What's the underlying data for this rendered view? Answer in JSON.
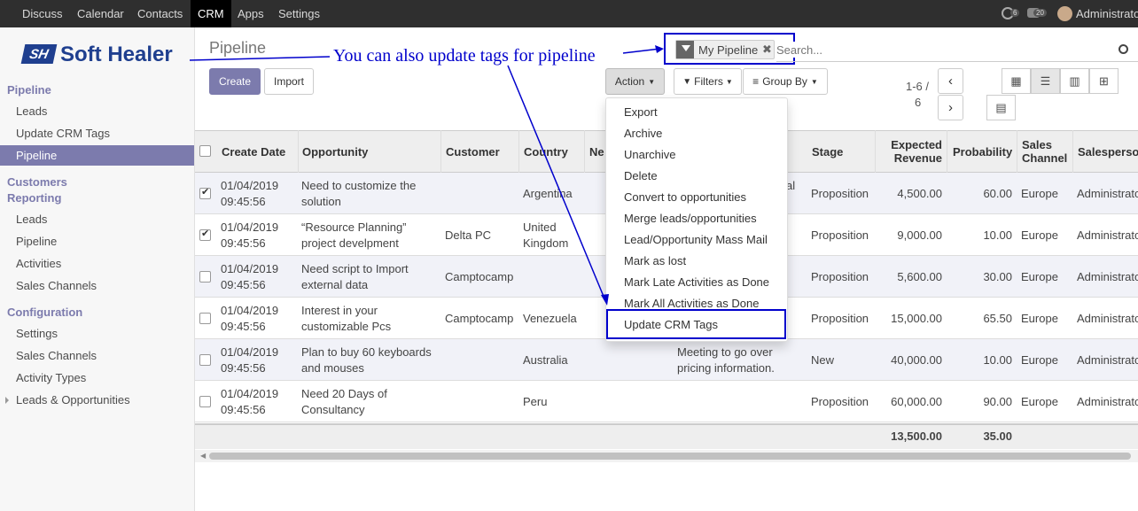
{
  "topbar": {
    "menus": [
      "Discuss",
      "Calendar",
      "Contacts",
      "CRM",
      "Apps",
      "Settings"
    ],
    "active": "CRM",
    "badge1": "6",
    "badge2": "20",
    "user": "Administrato"
  },
  "brand": {
    "name": "Soft Healer",
    "mark": "SH"
  },
  "sidebar": {
    "sec1": "Pipeline",
    "items1": [
      "Leads",
      "Update CRM Tags",
      "Pipeline"
    ],
    "sec2a": "Customers",
    "sec2b": "Reporting",
    "items2": [
      "Leads",
      "Pipeline",
      "Activities",
      "Sales Channels"
    ],
    "sec3": "Configuration",
    "items3": [
      "Settings",
      "Sales Channels",
      "Activity Types",
      "Leads & Opportunities"
    ]
  },
  "main": {
    "breadcrumb": "Pipeline",
    "create": "Create",
    "import": "Import",
    "action": "Action",
    "filters": "Filters",
    "groupby": "Group By",
    "pager": "1-6 /",
    "pager2": "6"
  },
  "search": {
    "facet": "My Pipeline",
    "placeholder": "Search..."
  },
  "annotation": "You can also update tags for pipeline",
  "table": {
    "headers": [
      "Create Date",
      "Opportunity",
      "Customer",
      "Country",
      "Ne",
      "Stage",
      "Expected",
      "Revenue",
      "Probability",
      "Sales",
      "Channel",
      "Salesperso"
    ],
    "rows": [
      {
        "d1": "01/04/2019",
        "d2": "09:45:56",
        "o1": "Need to customize the",
        "o2": "solution",
        "cust": "",
        "c1": "Argentina",
        "c2": "",
        "act": "al",
        "act2": "",
        "stage": "Proposition",
        "rev": "4,500.00",
        "prob": "60.00",
        "chan": "Europe",
        "sp": "Administrato",
        "checked": true
      },
      {
        "d1": "01/04/2019",
        "d2": "09:45:56",
        "o1": "“Resource Planning”",
        "o2": "project develpment",
        "cust": "Delta PC",
        "c1": "United",
        "c2": "Kingdom",
        "act": "",
        "act2": "",
        "stage": "Proposition",
        "rev": "9,000.00",
        "prob": "10.00",
        "chan": "Europe",
        "sp": "Administrato",
        "checked": true
      },
      {
        "d1": "01/04/2019",
        "d2": "09:45:56",
        "o1": "Need script to Import",
        "o2": "external data",
        "cust": "Camptocamp",
        "c1": "",
        "c2": "",
        "act": "",
        "act2": "",
        "stage": "Proposition",
        "rev": "5,600.00",
        "prob": "30.00",
        "chan": "Europe",
        "sp": "Administrato",
        "checked": false
      },
      {
        "d1": "01/04/2019",
        "d2": "09:45:56",
        "o1": "Interest in your",
        "o2": "customizable Pcs",
        "cust": "Camptocamp",
        "c1": "Venezuela",
        "c2": "",
        "act": "",
        "act2": "",
        "stage": "Proposition",
        "rev": "15,000.00",
        "prob": "65.50",
        "chan": "Europe",
        "sp": "Administrato",
        "checked": false
      },
      {
        "d1": "01/04/2019",
        "d2": "09:45:56",
        "o1": "Plan to buy 60 keyboards",
        "o2": "and mouses",
        "cust": "",
        "c1": "Australia",
        "c2": "",
        "act": "Meeting to go over",
        "act2": "pricing information.",
        "stage": "New",
        "rev": "40,000.00",
        "prob": "10.00",
        "chan": "Europe",
        "sp": "Administrato",
        "checked": false
      },
      {
        "d1": "01/04/2019",
        "d2": "09:45:56",
        "o1": "Need 20 Days of",
        "o2": "Consultancy",
        "cust": "",
        "c1": "Peru",
        "c2": "",
        "act": "",
        "act2": "",
        "stage": "Proposition",
        "rev": "60,000.00",
        "prob": "90.00",
        "chan": "Europe",
        "sp": "Administrato",
        "checked": false
      }
    ],
    "total_rev": "13,500.00",
    "total_prob": "35.00"
  },
  "action_menu": [
    "Export",
    "Archive",
    "Unarchive",
    "Delete",
    "Convert to opportunities",
    "Merge leads/opportunities",
    "Lead/Opportunity Mass Mail",
    "Mark as lost",
    "Mark Late Activities as Done",
    "Mark All Activities as Done",
    "Update CRM Tags"
  ],
  "colors": {
    "accent": "#7c7bad",
    "annot": "#0000cc"
  }
}
